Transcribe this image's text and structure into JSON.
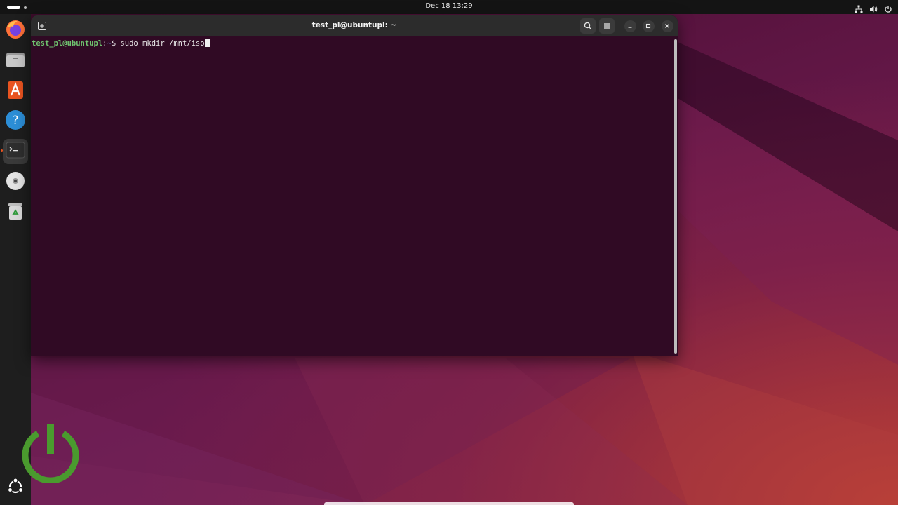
{
  "topbar": {
    "clock": "Dec 18  13:29",
    "tray_icons": [
      "network-icon",
      "volume-icon",
      "power-icon"
    ]
  },
  "dock": {
    "items": [
      {
        "name": "firefox",
        "icon": "firefox-icon"
      },
      {
        "name": "files",
        "icon": "files-icon"
      },
      {
        "name": "app-center",
        "icon": "app-center-icon"
      },
      {
        "name": "help",
        "icon": "help-icon"
      },
      {
        "name": "terminal",
        "icon": "terminal-icon",
        "active": true
      },
      {
        "name": "disc",
        "icon": "disc-icon"
      },
      {
        "name": "trash",
        "icon": "trash-icon"
      },
      {
        "name": "show-apps",
        "icon": "ubuntu-logo-icon"
      }
    ]
  },
  "terminal": {
    "title": "test_pl@ubuntupl: ~",
    "prompt_user": "test_pl@ubuntupl",
    "prompt_sep": ":",
    "prompt_path": "~",
    "prompt_symbol": "$ ",
    "command": "sudo mkdir /mnt/iso"
  },
  "colors": {
    "terminal_bg": "#300a24",
    "titlebar_bg": "#2c2c2c",
    "prompt_user": "#6fc36f",
    "prompt_path": "#6f8fd0",
    "ubuntu_orange": "#e95420",
    "power_logo_green": "#4a9a2e"
  }
}
